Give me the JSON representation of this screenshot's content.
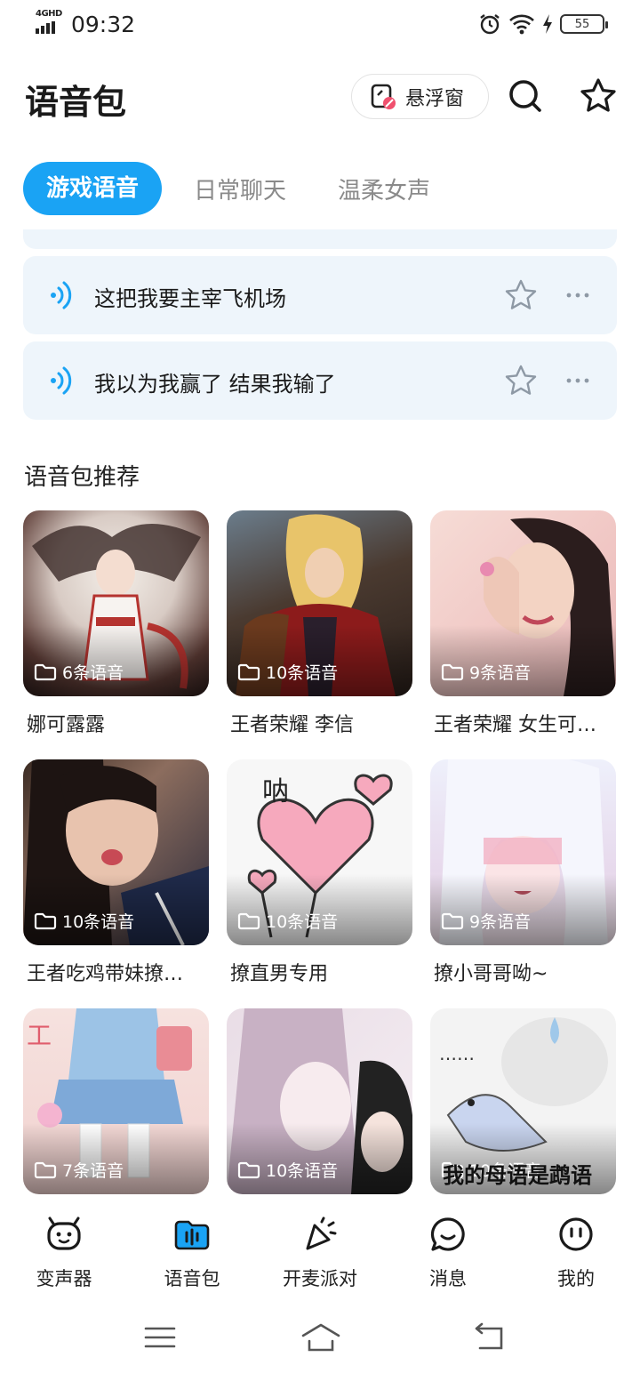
{
  "status_bar": {
    "network": "4GHD",
    "time": "09:32",
    "battery": "55"
  },
  "header": {
    "title": "语音包",
    "float_window_label": "悬浮窗"
  },
  "tabs": [
    {
      "label": "游戏语音",
      "active": true
    },
    {
      "label": "日常聊天",
      "active": false
    },
    {
      "label": "温柔女声",
      "active": false
    }
  ],
  "voices": [
    {
      "text": "这把我要主宰飞机场"
    },
    {
      "text": "我以为我赢了 结果我输了"
    }
  ],
  "recommend": {
    "title": "语音包推荐",
    "packs": [
      {
        "name": "娜可露露",
        "count": "6条语音"
      },
      {
        "name": "王者荣耀 李信",
        "count": "10条语音"
      },
      {
        "name": "王者荣耀 女生可…",
        "count": "9条语音"
      },
      {
        "name": "王者吃鸡带妹撩…",
        "count": "10条语音"
      },
      {
        "name": "撩直男专用",
        "count": "10条语音"
      },
      {
        "name": "撩小哥哥呦~",
        "count": "9条语音"
      },
      {
        "name": "",
        "count": "7条语音"
      },
      {
        "name": "",
        "count": "10条语音"
      },
      {
        "name": "",
        "count": "10条语音",
        "overlay_text": "我的母语是鹉语"
      }
    ]
  },
  "bottom_nav": [
    {
      "label": "变声器",
      "icon": "voice-changer-icon"
    },
    {
      "label": "语音包",
      "icon": "voice-pack-icon",
      "active": true
    },
    {
      "label": "开麦派对",
      "icon": "party-icon"
    },
    {
      "label": "消息",
      "icon": "message-icon"
    },
    {
      "label": "我的",
      "icon": "profile-icon"
    }
  ],
  "colors": {
    "accent": "#1aa3f4",
    "card_bg": "#eef5fb"
  }
}
